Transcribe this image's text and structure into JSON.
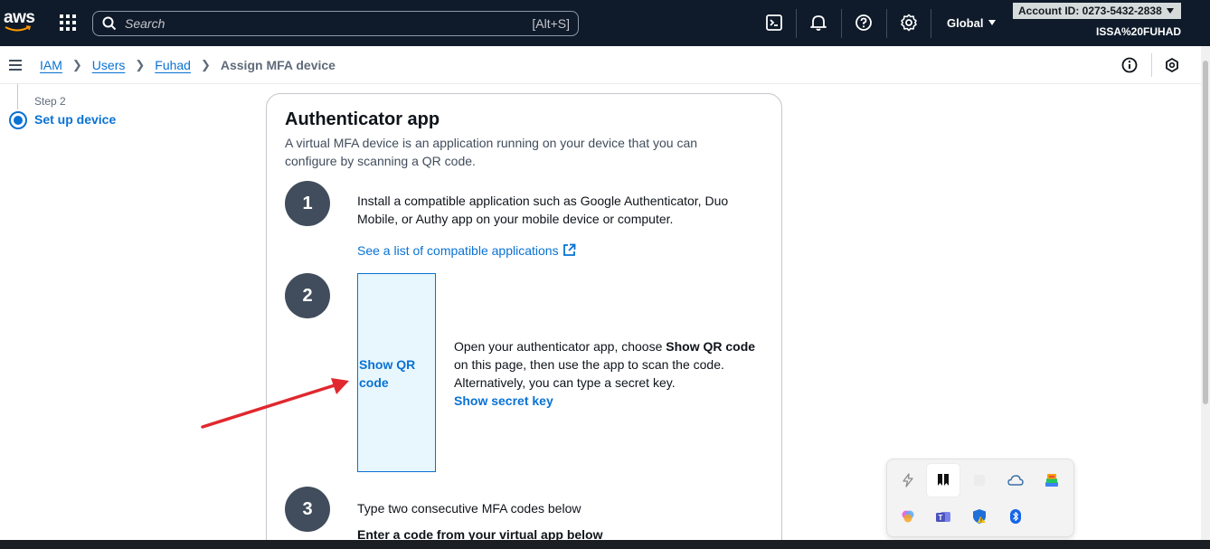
{
  "topnav": {
    "logo_text": "aws",
    "search_placeholder": "Search",
    "search_shortcut": "[Alt+S]",
    "region": "Global",
    "account": "Account ID: 0273-5432-2838",
    "user": "ISSA%20FUHAD",
    "icons": [
      "services-grid-icon",
      "search-icon",
      "cloudshell-icon",
      "bell-icon",
      "help-icon",
      "settings-icon"
    ]
  },
  "breadcrumb": {
    "items": [
      "IAM",
      "Users",
      "Fuhad"
    ],
    "current": "Assign MFA device"
  },
  "steps": {
    "caption": "Step 2",
    "title": "Set up device"
  },
  "card": {
    "title": "Authenticator app",
    "description": "A virtual MFA device is an application running on your device that you can configure by scanning a QR code.",
    "step1": {
      "number": "1",
      "text": "Install a compatible application such as Google Authenticator, Duo Mobile, or Authy app on your mobile device or computer.",
      "link": "See a list of compatible applications"
    },
    "step2": {
      "number": "2",
      "qr_button": "Show QR code",
      "text_before": "Open your authenticator app, choose ",
      "text_bold": "Show QR code",
      "text_after": " on this page, then use the app to scan the code. Alternatively, you can type a secret key.",
      "secret_link": "Show secret key"
    },
    "step3": {
      "number": "3",
      "text": "Type two consecutive MFA codes below",
      "subheading": "Enter a code from your virtual app below"
    }
  },
  "colors": {
    "nav_bg": "#0f1b2a",
    "link": "#0972d3",
    "step_circle": "#414d5c",
    "annotation_arrow": "#e0282e",
    "qr_box_bg": "#e8f7fd"
  }
}
